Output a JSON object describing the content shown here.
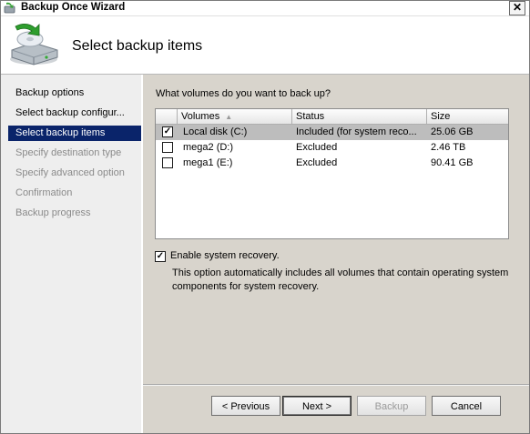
{
  "window": {
    "title": "Backup Once Wizard",
    "close_glyph": "✕"
  },
  "header": {
    "title": "Select backup items",
    "icon": "backup-disk-icon"
  },
  "nav": {
    "items": [
      {
        "label": "Backup options",
        "state": "enabled"
      },
      {
        "label": "Select backup configur...",
        "state": "enabled"
      },
      {
        "label": "Select backup items",
        "state": "selected"
      },
      {
        "label": "Specify destination type",
        "state": "disabled"
      },
      {
        "label": "Specify advanced option",
        "state": "disabled"
      },
      {
        "label": "Confirmation",
        "state": "disabled"
      },
      {
        "label": "Backup progress",
        "state": "disabled"
      }
    ]
  },
  "main": {
    "question": "What volumes do you want to back up?",
    "table": {
      "columns": [
        "Volumes",
        "Status",
        "Size"
      ],
      "sort_column": "Volumes",
      "rows": [
        {
          "checked": true,
          "volume": "Local disk (C:)",
          "status": "Included (for system reco...",
          "size": "25.06 GB",
          "selected": true
        },
        {
          "checked": false,
          "volume": "mega2 (D:)",
          "status": "Excluded",
          "size": "2.46 TB",
          "selected": false
        },
        {
          "checked": false,
          "volume": "mega1 (E:)",
          "status": "Excluded",
          "size": "90.41 GB",
          "selected": false
        }
      ]
    },
    "system_recovery": {
      "checked": true,
      "label": "Enable system recovery.",
      "description": "This option automatically includes all volumes that contain operating system components for system recovery."
    }
  },
  "buttons": {
    "previous": "< Previous",
    "next": "Next >",
    "backup": "Backup",
    "cancel": "Cancel"
  },
  "checkmark": "✓"
}
